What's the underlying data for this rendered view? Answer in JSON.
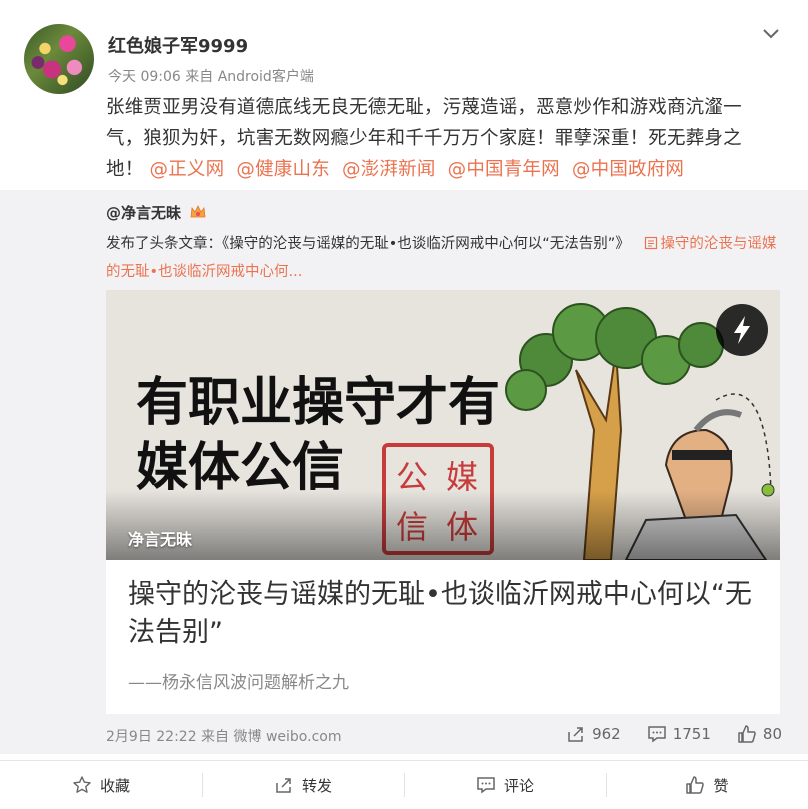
{
  "post": {
    "username": "红色娘子军9999",
    "meta": "今天 09:06 来自 Android客户端",
    "text": "张维贾亚男没有道德底线无良无德无耻，污蔑造谣，恶意炒作和游戏商沆瀣一气，狼狈为奸，坑害无数网瘾少年和千千万万个家庭！罪孽深重！死无葬身之地！",
    "mentions": [
      "@正义网",
      "@健康山东",
      "@澎湃新闻",
      "@中国青年网",
      "@中国政府网"
    ]
  },
  "repost": {
    "author": "@净言无昧",
    "text_prefix": "发布了头条文章：《操守的沦丧与谣媒的无耻•也谈临沂网戒中心何以“无法告别”》",
    "link_text": "操守的沦丧与谣媒的无耻•也谈临沂网戒中心何...",
    "card": {
      "image_line1": "有职业操守才有",
      "image_line2": "媒体公信",
      "seal_chars": [
        "媒",
        "公",
        "信",
        "体"
      ],
      "image_source": "净言无昧",
      "title": "操守的沦丧与谣媒的无耻•也谈临沂网戒中心何以“无法告别”",
      "subtitle": "——杨永信风波问题解析之九"
    },
    "meta": "2月9日 22:22 来自 微博 weibo.com",
    "stats": {
      "reposts": "962",
      "comments": "1751",
      "likes": "80"
    }
  },
  "actions": {
    "favorite": "收藏",
    "forward": "转发",
    "comment": "评论",
    "like": "赞"
  },
  "colors": {
    "link": "#eb7350",
    "repost_bg": "#f2f2f5",
    "muted": "#888888"
  }
}
